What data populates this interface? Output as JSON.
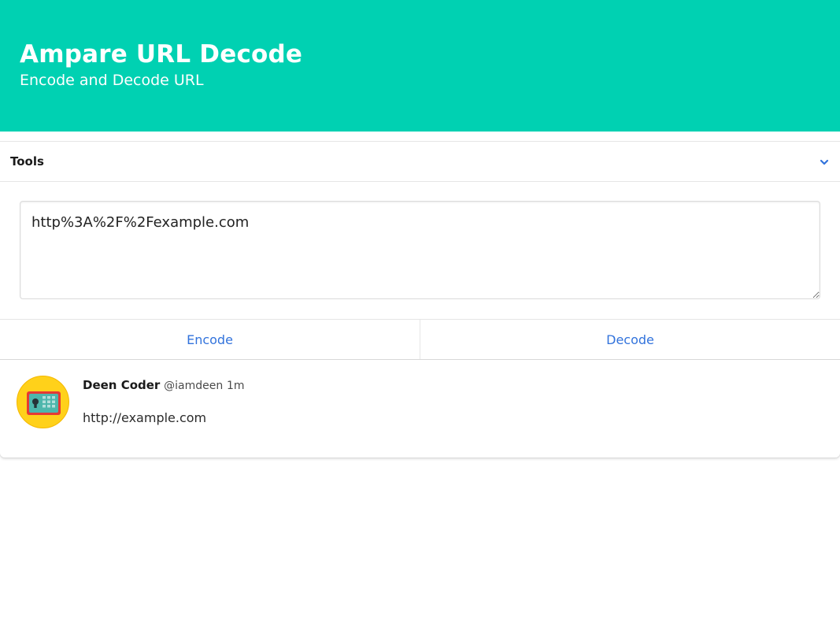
{
  "hero": {
    "title": "Ampare URL Decode",
    "subtitle": "Encode and Decode URL",
    "background": "#00d1b2"
  },
  "tools": {
    "label": "Tools",
    "toggle_icon": "chevron-down-icon"
  },
  "input": {
    "value": "http%3A%2F%2Fexample.com"
  },
  "actions": {
    "encode_label": "Encode",
    "decode_label": "Decode",
    "link_color": "#3273dc"
  },
  "result": {
    "avatar_icon": "safe-icon",
    "author_name": "Deen Coder",
    "author_handle": "@iamdeen",
    "time": "1m",
    "text": "http://example.com"
  }
}
